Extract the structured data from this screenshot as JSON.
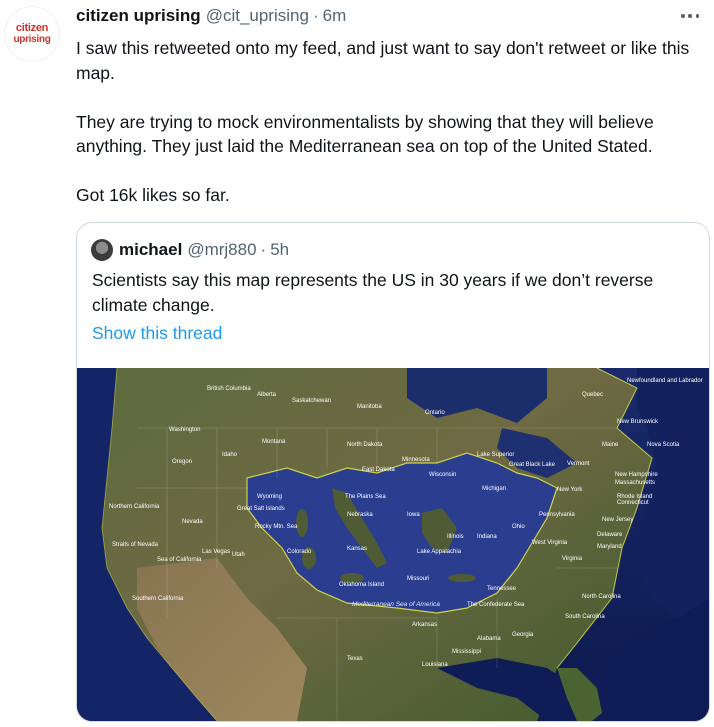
{
  "tweet": {
    "avatar_line1": "citizen",
    "avatar_line2": "uprising",
    "author_name": "citizen uprising",
    "author_handle": "@cit_uprising",
    "separator": "·",
    "time": "6m",
    "paragraphs": [
      "I saw this retweeted onto my feed, and just want to say don't retweet or like this map.",
      "They are trying to mock environmentalists by showing that they will believe anything. They just laid the Mediterranean sea on top of the United Stated.",
      "Got 16k likes so far."
    ]
  },
  "quoted": {
    "author_name": "michael",
    "author_handle": "@mrj880",
    "separator": "·",
    "time": "5h",
    "text": "Scientists say this map represents the US in 30 years if we don’t reverse climate change.",
    "show_thread": "Show this thread"
  },
  "map": {
    "labels": {
      "british_columbia": "British Columbia",
      "alberta": "Alberta",
      "saskatchewan": "Saskatchewan",
      "manitoba": "Manitoba",
      "ontario": "Ontario",
      "quebec": "Quebec",
      "newfoundland": "Newfoundland and Labrador",
      "washington": "Washington",
      "oregon": "Oregon",
      "idaho": "Idaho",
      "montana": "Montana",
      "north_dakota": "North Dakota",
      "minnesota": "Minnesota",
      "wisconsin": "Wisconsin",
      "michigan": "Michigan",
      "new_york": "New York",
      "vermont": "Vermont",
      "maine": "Maine",
      "new_brunswick": "New Brunswick",
      "nova_scotia": "Nova Scotia",
      "new_hampshire": "New Hampshire",
      "massachusetts": "Massachusetts",
      "rhode_island": "Rhode Island",
      "connecticut": "Connecticut",
      "new_jersey": "New Jersey",
      "delaware": "Delaware",
      "maryland": "Maryland",
      "pennsylvania": "Pennsylvania",
      "ohio": "Ohio",
      "west_virginia": "West Virginia",
      "virginia": "Virginia",
      "north_carolina": "North Carolina",
      "south_carolina": "South Carolina",
      "georgia": "Georgia",
      "alabama": "Alabama",
      "mississippi": "Mississippi",
      "tennessee": "Tennessee",
      "louisiana": "Louisiana",
      "arkansas": "Arkansas",
      "texas": "Texas",
      "oklahoma": "Oklahoma Island",
      "kansas": "Kansas",
      "missouri": "Missouri",
      "illinois": "Illinois",
      "indiana": "Indiana",
      "iowa": "Iowa",
      "nebraska": "Nebraska",
      "wyoming": "Wyoming",
      "utah": "Utah",
      "colorado": "Colorado",
      "nevada": "Nevada",
      "las_vegas": "Las Vegas",
      "northern_california": "Northern California",
      "southern_california": "Southern California",
      "strait": "Straits of Nevada",
      "great_salt": "Great Salt Islands",
      "rocky_mtn": "Rocky Mtn. Sea",
      "sea_of_california": "Sea of California",
      "mediterranean": "Mediterranean Sea of America",
      "plains_sea": "The Plains Sea",
      "confederate_sea": "The Confederate Sea",
      "great_black_lake": "Great Black Lake",
      "lake_superior": "Lake Superior",
      "sea_of_lakes": "Lake Appalachia",
      "south_dakota": "East Dakota"
    }
  }
}
